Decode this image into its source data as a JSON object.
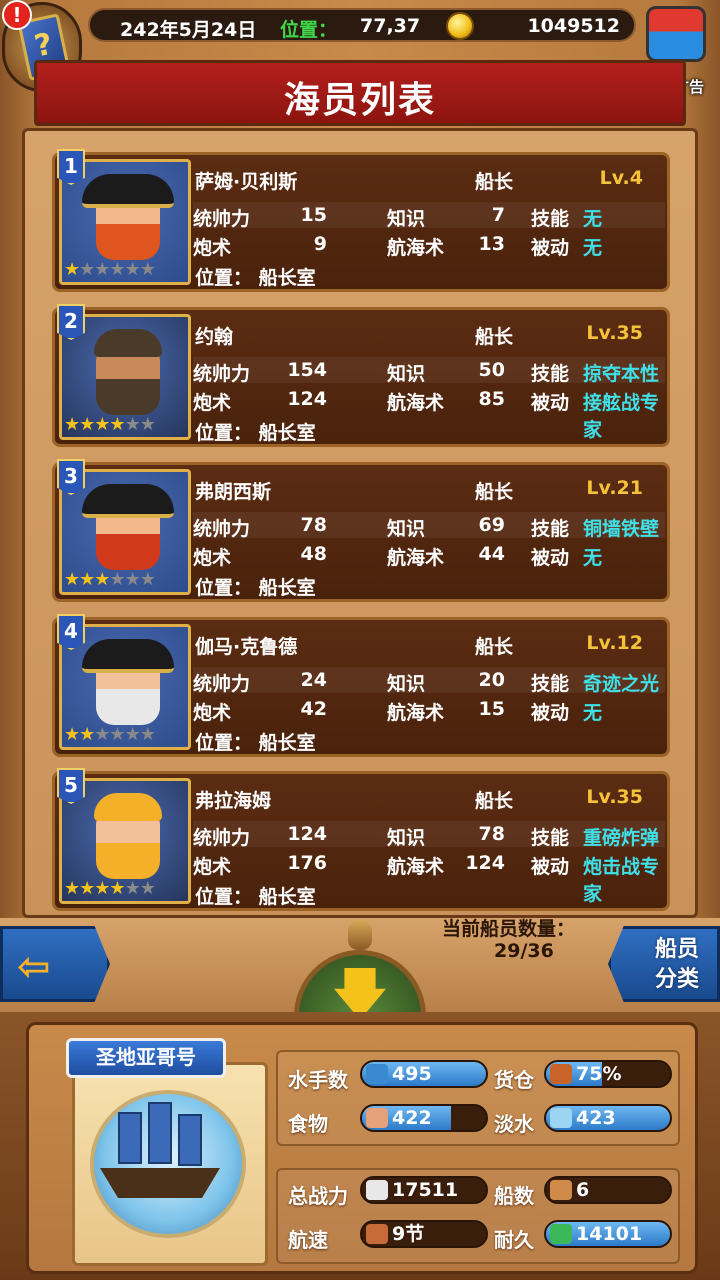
{
  "status_bar": {
    "date": "242年5月24日",
    "position_label": "位置：",
    "position_value": "77,37",
    "gold": "1049512"
  },
  "alert_badge": "!",
  "book_glyph": "?",
  "ad_label": "暂无广告",
  "title": "海员列表",
  "crew": [
    {
      "index": "1",
      "name": "萨姆·贝利斯",
      "role": "船长",
      "level": "Lv.4",
      "leadership_label": "统帅力",
      "leadership": "15",
      "knowledge_label": "知识",
      "knowledge": "7",
      "skill_label": "技能",
      "skill": "无",
      "gunnery_label": "炮术",
      "gunnery": "9",
      "navigation_label": "航海术",
      "navigation": "13",
      "passive_label": "被动",
      "passive": "无",
      "location": "位置：  船长室",
      "stars": 1,
      "max_stars": 6,
      "look": {
        "hat": true,
        "beard": "#e0541e",
        "skin": "#f2b98a",
        "bg": "#2c4c8c"
      }
    },
    {
      "index": "2",
      "name": "约翰",
      "role": "船长",
      "level": "Lv.35",
      "leadership_label": "统帅力",
      "leadership": "154",
      "knowledge_label": "知识",
      "knowledge": "50",
      "skill_label": "技能",
      "skill": "掠夺本性",
      "gunnery_label": "炮术",
      "gunnery": "124",
      "navigation_label": "航海术",
      "navigation": "85",
      "passive_label": "被动",
      "passive": "接舷战专家",
      "location": "位置：  船长室",
      "stars": 4,
      "max_stars": 6,
      "look": {
        "hat": false,
        "beard": "#4a3a2a",
        "skin": "#c88a5a",
        "bg": "#26365c"
      }
    },
    {
      "index": "3",
      "name": "弗朗西斯",
      "role": "船长",
      "level": "Lv.21",
      "leadership_label": "统帅力",
      "leadership": "78",
      "knowledge_label": "知识",
      "knowledge": "69",
      "skill_label": "技能",
      "skill": "铜墙铁壁",
      "gunnery_label": "炮术",
      "gunnery": "48",
      "navigation_label": "航海术",
      "navigation": "44",
      "passive_label": "被动",
      "passive": "无",
      "location": "位置：  船长室",
      "stars": 3,
      "max_stars": 6,
      "look": {
        "hat": true,
        "beard": "#d03a1a",
        "skin": "#f2b98a",
        "bg": "#2c4c8c"
      }
    },
    {
      "index": "4",
      "name": "伽马·克鲁德",
      "role": "船长",
      "level": "Lv.12",
      "leadership_label": "统帅力",
      "leadership": "24",
      "knowledge_label": "知识",
      "knowledge": "20",
      "skill_label": "技能",
      "skill": "奇迹之光",
      "gunnery_label": "炮术",
      "gunnery": "42",
      "navigation_label": "航海术",
      "navigation": "15",
      "passive_label": "被动",
      "passive": "无",
      "location": "位置：  船长室",
      "stars": 2,
      "max_stars": 6,
      "look": {
        "hat": true,
        "beard": "#e8e8e8",
        "skin": "#f2c09a",
        "bg": "#2c4c8c"
      }
    },
    {
      "index": "5",
      "name": "弗拉海姆",
      "role": "船长",
      "level": "Lv.35",
      "leadership_label": "统帅力",
      "leadership": "124",
      "knowledge_label": "知识",
      "knowledge": "78",
      "skill_label": "技能",
      "skill": "重磅炸弹",
      "gunnery_label": "炮术",
      "gunnery": "176",
      "navigation_label": "航海术",
      "navigation": "124",
      "passive_label": "被动",
      "passive": "炮击战专家",
      "location": "位置：  船长室",
      "stars": 4,
      "max_stars": 6,
      "look": {
        "hat": false,
        "beard": "#f5b02a",
        "skin": "#f2c09a",
        "bg": "#26365c"
      }
    }
  ],
  "controls": {
    "crew_count_label": "当前船员数量：",
    "crew_count_value": "29/36",
    "classify_line1": "船员",
    "classify_line2": "分类"
  },
  "ship": {
    "name": "圣地亚哥号",
    "stats": {
      "sailors_label": "水手数",
      "sailors": "495",
      "cargo_label": "货仓",
      "cargo": "75%",
      "food_label": "食物",
      "food": "422",
      "water_label": "淡水",
      "water": "423",
      "power_label": "总战力",
      "power": "17511",
      "ships_label": "船数",
      "ships": "6",
      "speed_label": "航速",
      "speed": "9节",
      "durability_label": "耐久",
      "durability": "14101"
    },
    "bar_fill": {
      "sailors": 1.0,
      "cargo": 0.45,
      "food": 0.72,
      "water": 1.0,
      "power": 0,
      "ships": 0,
      "speed": 0,
      "durability": 1.0
    }
  },
  "colors": {
    "skill_text": "#3fe0e8",
    "level_text": "#f5c33a",
    "position_label": "#3fd84a",
    "banner_red": "#b3201c"
  }
}
